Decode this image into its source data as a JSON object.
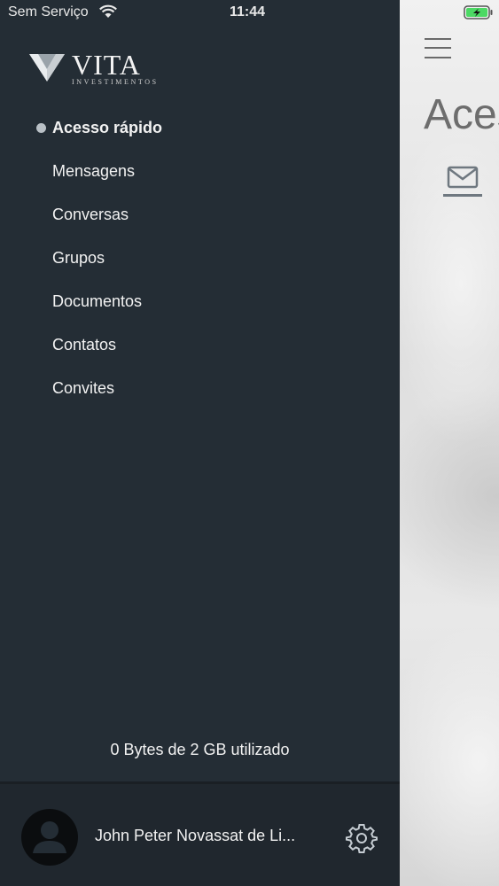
{
  "status_bar": {
    "carrier": "Sem Serviço",
    "time": "11:44",
    "wifi_icon": "wifi-icon",
    "battery_icon": "battery-charging-icon",
    "battery_color": "#4cd964"
  },
  "background_screen": {
    "title": "Aces",
    "menu_icon": "hamburger-icon",
    "tab_icon": "mail-icon"
  },
  "drawer": {
    "logo": {
      "name": "VITA",
      "subtitle": "INVESTIMENTOS"
    },
    "menu_items": [
      {
        "label": "Acesso rápido",
        "active": true
      },
      {
        "label": "Mensagens",
        "active": false
      },
      {
        "label": "Conversas",
        "active": false
      },
      {
        "label": "Grupos",
        "active": false
      },
      {
        "label": "Documentos",
        "active": false
      },
      {
        "label": "Contatos",
        "active": false
      },
      {
        "label": "Convites",
        "active": false
      }
    ],
    "storage_text": "0 Bytes de 2 GB utilizado",
    "profile": {
      "name": "John Peter Novassat de Li...",
      "avatar_icon": "user-avatar-icon",
      "settings_icon": "gear-icon"
    },
    "colors": {
      "background": "#242d35",
      "text": "#f2f2f2",
      "active_dot": "#b9c0c6"
    }
  }
}
